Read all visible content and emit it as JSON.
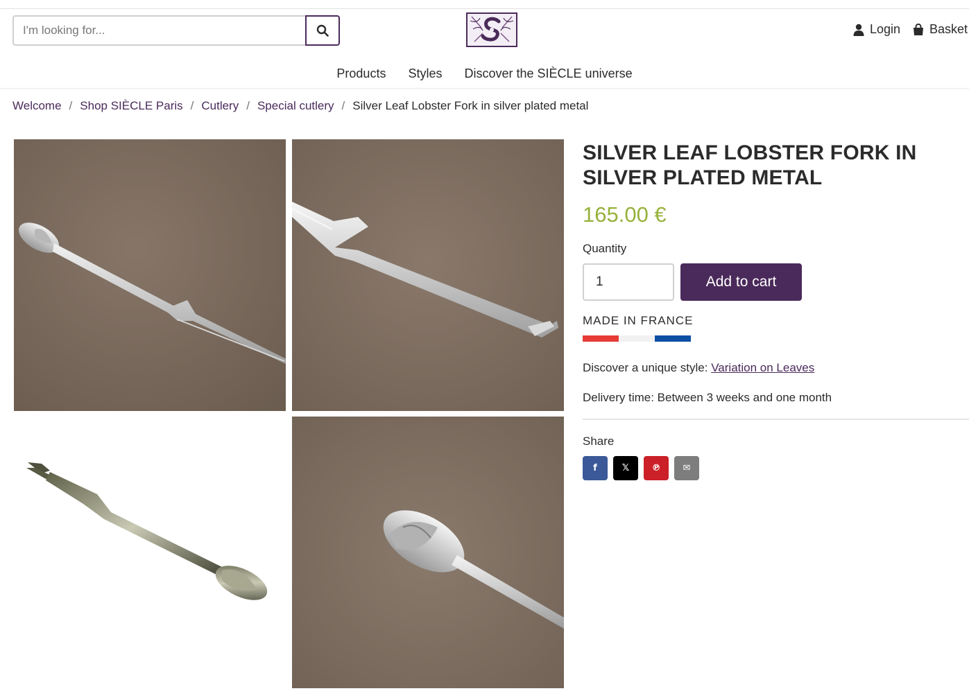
{
  "search": {
    "placeholder": "I'm looking for..."
  },
  "account": {
    "login_label": "Login",
    "basket_label": "Basket"
  },
  "nav": {
    "items": [
      "Products",
      "Styles",
      "Discover the SIÈCLE universe"
    ]
  },
  "breadcrumb": {
    "items": [
      "Welcome",
      "Shop SIÈCLE Paris",
      "Cutlery",
      "Special cutlery"
    ],
    "current": "Silver Leaf Lobster Fork in silver plated metal",
    "separator": "/"
  },
  "product": {
    "title": "SILVER LEAF LOBSTER FORK IN SILVER PLATED METAL",
    "price": "165.00 €",
    "quantity_label": "Quantity",
    "quantity_value": "1",
    "add_to_cart_label": "Add to cart",
    "made_in": "MADE IN FRANCE",
    "style_prefix": "Discover a unique style:",
    "style_link": "Variation on Leaves",
    "delivery": "Delivery time: Between 3 weeks and one month",
    "share_label": "Share"
  },
  "share": [
    {
      "name": "facebook",
      "glyph": "f",
      "color": "#3b5998"
    },
    {
      "name": "x",
      "glyph": "𝕏",
      "color": "#000000"
    },
    {
      "name": "pinterest",
      "glyph": "℗",
      "color": "#cb2027"
    },
    {
      "name": "email",
      "glyph": "✉",
      "color": "#7d7d7d"
    }
  ],
  "colors": {
    "brand": "#4a2a5a",
    "price": "#96b23c",
    "flag_blue": "#0d4fa3",
    "flag_white": "#f2f2f2",
    "flag_red": "#e63c35",
    "photo_bg": "#7a6a5d"
  }
}
